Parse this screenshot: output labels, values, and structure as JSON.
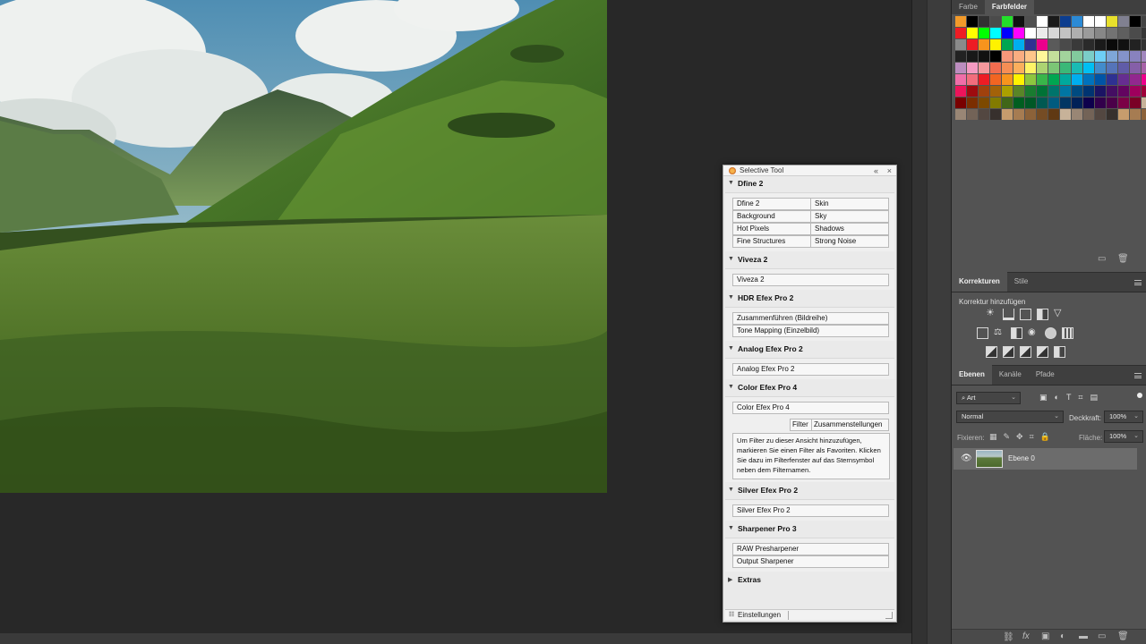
{
  "selective_tool": {
    "title": "Selective Tool",
    "sections": {
      "dfine": {
        "title": "Dfine 2",
        "buttons": [
          "Dfine 2",
          "Skin",
          "Background",
          "Sky",
          "Hot Pixels",
          "Shadows",
          "Fine Structures",
          "Strong Noise"
        ]
      },
      "viveza": {
        "title": "Viveza 2",
        "buttons": [
          "Viveza 2"
        ]
      },
      "hdr": {
        "title": "HDR Efex Pro 2",
        "buttons": [
          "Zusammenführen (Bildreihe)",
          "Tone Mapping (Einzelbild)"
        ]
      },
      "analog": {
        "title": "Analog Efex Pro 2",
        "buttons": [
          "Analog Efex Pro 2"
        ]
      },
      "color": {
        "title": "Color Efex Pro 4",
        "buttons": [
          "Color Efex Pro 4"
        ],
        "tabs": [
          "Filter",
          "Zusammenstellungen"
        ],
        "info": "Um Filter zu dieser Ansicht hinzuzufügen, markieren Sie einen Filter als Favoriten. Klicken Sie dazu im Filterfenster auf das Sternsymbol neben dem Filternamen."
      },
      "silver": {
        "title": "Silver Efex Pro 2",
        "buttons": [
          "Silver Efex Pro 2"
        ]
      },
      "sharpener": {
        "title": "Sharpener Pro 3",
        "buttons": [
          "RAW Presharpener",
          "Output Sharpener"
        ]
      },
      "extras": {
        "title": "Extras"
      }
    },
    "footer_label": "Einstellungen"
  },
  "panels": {
    "swatches_tabs": [
      "Farbe",
      "Farbfelder"
    ],
    "korrekturen_tabs": [
      "Korrekturen",
      "Stile"
    ],
    "korrektur_title": "Korrektur hinzufügen",
    "layers_tabs": [
      "Ebenen",
      "Kanäle",
      "Pfade"
    ],
    "filter_kind": "Art",
    "blend_mode": "Normal",
    "opacity_label": "Deckkraft:",
    "opacity_value": "100%",
    "lock_label": "Fixieren:",
    "fill_label": "Fläche:",
    "fill_value": "100%",
    "layer_name": "Ebene 0"
  },
  "swatch_colors": [
    "#f29a2a",
    "#000000",
    "#323232",
    "#4b4b4b",
    "#22e02a",
    "#111111",
    "#4f4f4f",
    "#ffffff",
    "#1a1a1a",
    "#0c3d8f",
    "#2b8ad6",
    "#ffffff",
    "#ffffff",
    "#e8e02c",
    "#808090",
    "#000000",
    "#444444",
    "#ee1c24",
    "#ffff00",
    "#00ff00",
    "#00ffff",
    "#0000ff",
    "#ff00ff",
    "#ffffff",
    "#ebebeb",
    "#d7d7d7",
    "#c3c3c3",
    "#afafaf",
    "#9b9b9b",
    "#878787",
    "#737373",
    "#5f5f5f",
    "#4b4b4b",
    "#373737",
    "#8a8a8a",
    "#ed1c24",
    "#f7941d",
    "#fff200",
    "#00a651",
    "#00aeef",
    "#2e3192",
    "#ec008c",
    "#5a5a5a",
    "#4a4a4a",
    "#3a3a3a",
    "#2a2a2a",
    "#1a1a1a",
    "#0a0a0a",
    "#111111",
    "#222222",
    "#333333",
    "#222222",
    "#181818",
    "#111111",
    "#000000",
    "#f7977a",
    "#f9ad81",
    "#fdc68a",
    "#fff79a",
    "#c4df9b",
    "#a2d39c",
    "#82ca9d",
    "#7bcdc8",
    "#6ecff6",
    "#7ea7d8",
    "#8493ca",
    "#8882be",
    "#a187be",
    "#bc8dbf",
    "#f49ac2",
    "#f6989d",
    "#f26c4f",
    "#f68e55",
    "#fbaf5d",
    "#fff467",
    "#acd372",
    "#7cc576",
    "#3bb878",
    "#1abbb4",
    "#00bff3",
    "#438ccb",
    "#5574b9",
    "#605ca8",
    "#855fa8",
    "#a763a8",
    "#f06ea9",
    "#f26d7d",
    "#ed1c24",
    "#f26522",
    "#f7941d",
    "#fff200",
    "#8dc63f",
    "#39b54a",
    "#00a651",
    "#00a99d",
    "#00aeef",
    "#0072bc",
    "#0054a6",
    "#2e3192",
    "#662d91",
    "#92278f",
    "#ec008c",
    "#ed145b",
    "#9e0b0f",
    "#a0410d",
    "#a36209",
    "#aba000",
    "#598527",
    "#1a7b30",
    "#007236",
    "#00746b",
    "#0076a3",
    "#004b80",
    "#003471",
    "#1b1464",
    "#440e62",
    "#630460",
    "#9e005d",
    "#9e0039",
    "#790000",
    "#7b2e00",
    "#7d4900",
    "#827b00",
    "#406618",
    "#005e20",
    "#005826",
    "#005952",
    "#005b7f",
    "#003663",
    "#002157",
    "#0d004c",
    "#32004b",
    "#4b0049",
    "#7b0046",
    "#7a0026",
    "#c7b299",
    "#998675",
    "#736357",
    "#534741",
    "#37302d",
    "#c69c6d",
    "#a67c52",
    "#8c6239",
    "#754c24",
    "#603913",
    "#c7b299",
    "#998675",
    "#736357",
    "#534741",
    "#37302d",
    "#c69c6d",
    "#a67c52",
    "#8c6239"
  ]
}
